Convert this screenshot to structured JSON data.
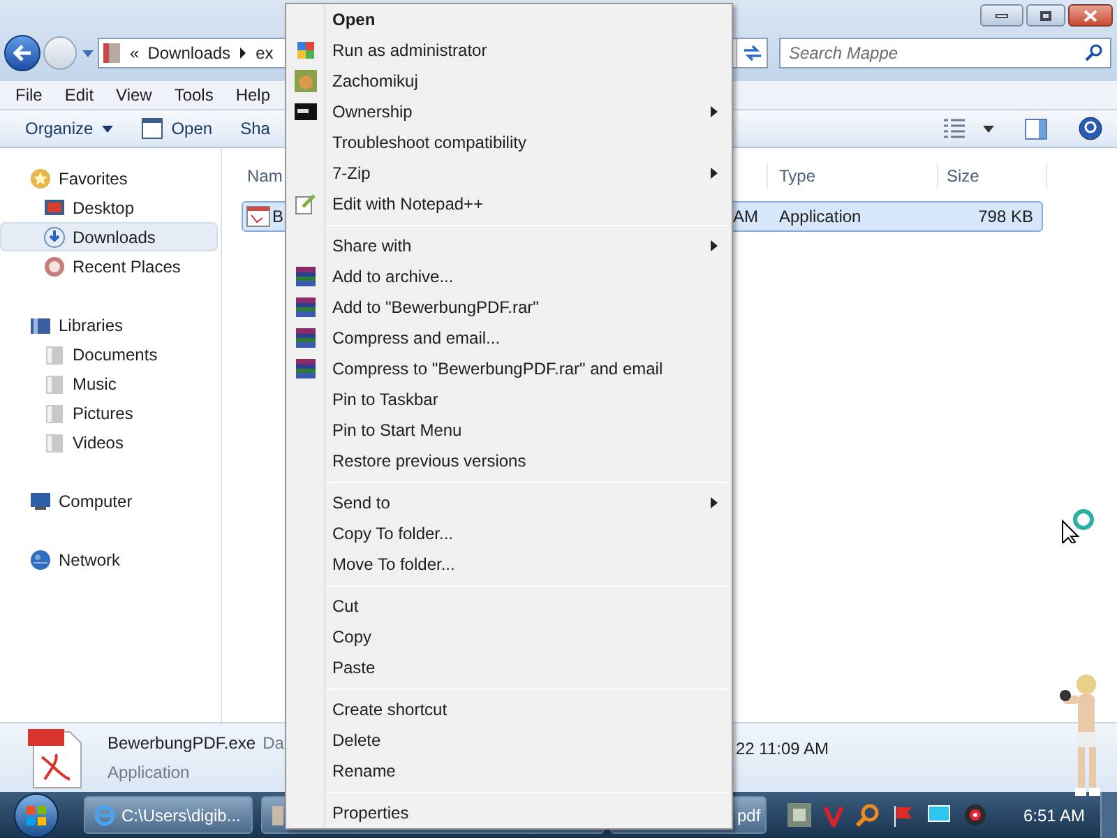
{
  "address": {
    "prefix": "«",
    "crumbs": [
      "Downloads",
      "ex"
    ]
  },
  "search": {
    "placeholder": "Search Mappe"
  },
  "menu_bar": [
    "File",
    "Edit",
    "View",
    "Tools",
    "Help"
  ],
  "toolbar": [
    {
      "label": "Organize",
      "kind": "dropdown"
    },
    {
      "label": "Open",
      "kind": "open"
    },
    {
      "label": "Sha",
      "kind": "plain"
    }
  ],
  "sidebar": [
    {
      "label": "Favorites",
      "kind": "star",
      "selected": false,
      "children": [
        {
          "label": "Desktop",
          "kind": "desktop",
          "selected": false
        },
        {
          "label": "Downloads",
          "kind": "downloads",
          "selected": true
        },
        {
          "label": "Recent Places",
          "kind": "recent",
          "selected": false
        }
      ]
    },
    {
      "label": "Libraries",
      "kind": "libraries",
      "selected": false,
      "children": [
        {
          "label": "Documents",
          "kind": "library",
          "selected": false
        },
        {
          "label": "Music",
          "kind": "library",
          "selected": false
        },
        {
          "label": "Pictures",
          "kind": "library",
          "selected": false
        },
        {
          "label": "Videos",
          "kind": "library",
          "selected": false
        }
      ]
    },
    {
      "label": "Computer",
      "kind": "computer",
      "selected": false
    },
    {
      "label": "Network",
      "kind": "network",
      "selected": false
    }
  ],
  "columns": [
    "Nam",
    "Type",
    "Size"
  ],
  "rows": [
    {
      "name": "B",
      "modified": "AM",
      "type": "Application",
      "size": "798 KB",
      "selected": true
    }
  ],
  "details": {
    "name": "BewerbungPDF.exe",
    "date_label": "Da",
    "type": "Application",
    "date": "22 11:09 AM"
  },
  "context_menu": [
    {
      "label": "Open",
      "kind": "plain",
      "default": true,
      "submenu": false
    },
    {
      "label": "Run as administrator",
      "kind": "shield",
      "default": false,
      "submenu": false
    },
    {
      "label": "Zachomikuj",
      "kind": "app",
      "default": false,
      "submenu": false
    },
    {
      "label": "Ownership",
      "kind": "console",
      "default": false,
      "submenu": true
    },
    {
      "label": "Troubleshoot compatibility",
      "kind": "plain",
      "default": false,
      "submenu": false
    },
    {
      "label": "7-Zip",
      "kind": "plain",
      "default": false,
      "submenu": true
    },
    {
      "label": "Edit with Notepad++",
      "kind": "notepad",
      "default": false,
      "submenu": false
    },
    {
      "kind": "separator"
    },
    {
      "label": "Share with",
      "kind": "plain",
      "default": false,
      "submenu": true
    },
    {
      "label": "Add to archive...",
      "kind": "archive",
      "default": false,
      "submenu": false
    },
    {
      "label": "Add to \"BewerbungPDF.rar\"",
      "kind": "archive",
      "default": false,
      "submenu": false
    },
    {
      "label": "Compress and email...",
      "kind": "archive",
      "default": false,
      "submenu": false
    },
    {
      "label": "Compress to \"BewerbungPDF.rar\" and email",
      "kind": "archive",
      "default": false,
      "submenu": false
    },
    {
      "label": "Pin to Taskbar",
      "kind": "plain",
      "default": false,
      "submenu": false
    },
    {
      "label": "Pin to Start Menu",
      "kind": "plain",
      "default": false,
      "submenu": false
    },
    {
      "label": "Restore previous versions",
      "kind": "plain",
      "default": false,
      "submenu": false
    },
    {
      "kind": "separator"
    },
    {
      "label": "Send to",
      "kind": "plain",
      "default": false,
      "submenu": true
    },
    {
      "label": "Copy To folder...",
      "kind": "plain",
      "default": false,
      "submenu": false
    },
    {
      "label": "Move To folder...",
      "kind": "plain",
      "default": false,
      "submenu": false
    },
    {
      "kind": "separator"
    },
    {
      "label": "Cut",
      "kind": "plain",
      "default": false,
      "submenu": false
    },
    {
      "label": "Copy",
      "kind": "plain",
      "default": false,
      "submenu": false
    },
    {
      "label": "Paste",
      "kind": "plain",
      "default": false,
      "submenu": false
    },
    {
      "kind": "separator"
    },
    {
      "label": "Create shortcut",
      "kind": "plain",
      "default": false,
      "submenu": false
    },
    {
      "label": "Delete",
      "kind": "plain",
      "default": false,
      "submenu": false
    },
    {
      "label": "Rename",
      "kind": "plain",
      "default": false,
      "submenu": false
    },
    {
      "kind": "separator"
    },
    {
      "label": "Properties",
      "kind": "plain",
      "default": false,
      "submenu": false
    }
  ],
  "taskbar": {
    "tasks": [
      {
        "label": "C:\\Users\\digib...",
        "kind": "browser"
      },
      {
        "kind": "folder"
      },
      {
        "label": "pdf",
        "kind": "document"
      }
    ],
    "clock": "6:51 AM"
  }
}
